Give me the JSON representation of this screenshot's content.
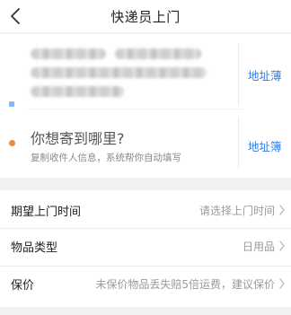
{
  "header": {
    "title": "快递员上门",
    "back_icon": "chevron-left-icon"
  },
  "sender": {
    "address_book_label": "地址薄"
  },
  "receiver": {
    "prompt": "你想寄到哪里?",
    "hint": "复制收件人信息，系统帮你自动填写",
    "address_book_label": "地址簿"
  },
  "options": [
    {
      "label": "期望上门时间",
      "value": "请选择上门时间"
    },
    {
      "label": "物品类型",
      "value": "日用品"
    },
    {
      "label": "保价",
      "value": "未保价物品丢失赔5倍运费，建议保价"
    }
  ],
  "colors": {
    "link": "#2b7de9",
    "sender_dot": "#8ab6f0",
    "receiver_dot": "#f0883a"
  }
}
